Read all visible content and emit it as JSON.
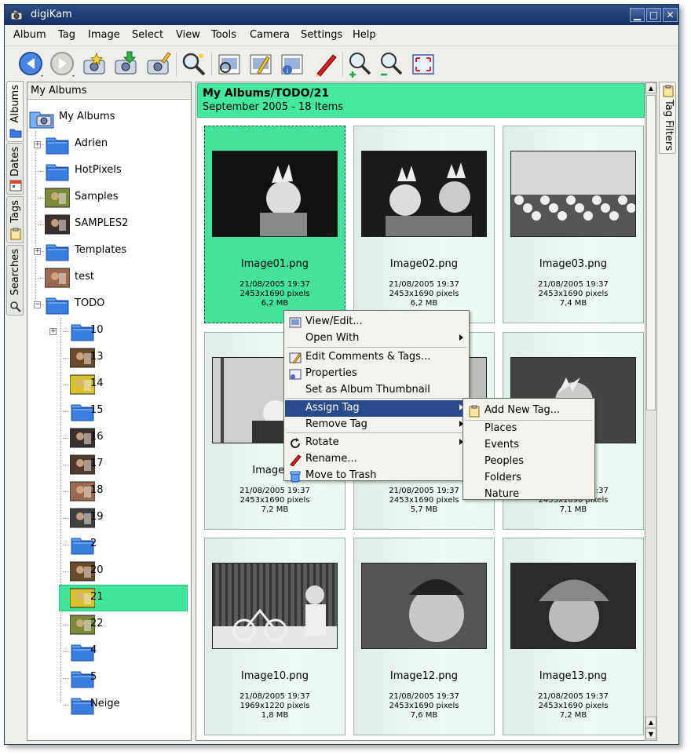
{
  "window": {
    "title": "digiKam"
  },
  "menubar": [
    {
      "label": "Album"
    },
    {
      "label": "Tag"
    },
    {
      "label": "Image"
    },
    {
      "label": "Select"
    },
    {
      "label": "View"
    },
    {
      "label": "Tools"
    },
    {
      "label": "Camera"
    },
    {
      "label": "Settings"
    },
    {
      "label": "Help"
    }
  ],
  "toolbar": [
    {
      "icon": "back-arrow-icon"
    },
    {
      "icon": "forward-arrow-icon"
    },
    {
      "icon": "new-album-camera-icon"
    },
    {
      "icon": "import-download-icon"
    },
    {
      "icon": "edit-album-icon"
    },
    {
      "icon": "search-magnifier-icon"
    },
    {
      "icon": "image-view-icon"
    },
    {
      "icon": "image-edit-icon"
    },
    {
      "icon": "image-properties-icon"
    },
    {
      "icon": "red-pencil-icon"
    },
    {
      "icon": "zoom-in-icon"
    },
    {
      "icon": "zoom-out-icon"
    },
    {
      "icon": "fullscreen-icon"
    }
  ],
  "left_tabs": [
    {
      "label": "Albums"
    },
    {
      "label": "Dates"
    },
    {
      "label": "Tags"
    },
    {
      "label": "Searches"
    }
  ],
  "right_tabs": [
    {
      "label": "Tag Filters"
    }
  ],
  "tree": {
    "header": "My Albums",
    "root": "My Albums",
    "items": [
      {
        "label": "Adrien",
        "icon": "folder"
      },
      {
        "label": "HotPixels",
        "icon": "folder"
      },
      {
        "label": "Samples",
        "icon": "photo"
      },
      {
        "label": "SAMPLES2",
        "icon": "photo"
      },
      {
        "label": "Templates",
        "icon": "folder"
      },
      {
        "label": "test",
        "icon": "photo"
      },
      {
        "label": "TODO",
        "icon": "folder"
      },
      {
        "label": "10",
        "icon": "folder"
      },
      {
        "label": "13",
        "icon": "photo"
      },
      {
        "label": "14",
        "icon": "photo"
      },
      {
        "label": "15",
        "icon": "folder"
      },
      {
        "label": "16",
        "icon": "photo"
      },
      {
        "label": "17",
        "icon": "photo"
      },
      {
        "label": "18",
        "icon": "photo"
      },
      {
        "label": "19",
        "icon": "photo"
      },
      {
        "label": "2",
        "icon": "folder"
      },
      {
        "label": "20",
        "icon": "photo"
      },
      {
        "label": "21",
        "icon": "photo",
        "selected": true
      },
      {
        "label": "22",
        "icon": "photo"
      },
      {
        "label": "4",
        "icon": "folder"
      },
      {
        "label": "5",
        "icon": "folder"
      },
      {
        "label": "Neige",
        "icon": "folder"
      }
    ]
  },
  "album": {
    "title": "My Albums/TODO/21",
    "subtitle": "September 2005 - 18 Items"
  },
  "thumbnails": [
    {
      "name": "Image01.png",
      "date": "21/08/2005 19:37",
      "dims": "2453x1690 pixels",
      "size": "6,2 MB",
      "selected": true
    },
    {
      "name": "Image02.png",
      "date": "21/08/2005 19:37",
      "dims": "2453x1690 pixels",
      "size": "6,2 MB"
    },
    {
      "name": "Image03.png",
      "date": "21/08/2005 19:37",
      "dims": "2453x1690 pixels",
      "size": "7,4 MB"
    },
    {
      "name": "Image04",
      "date": "21/08/2005 19:37",
      "dims": "2453x1690 pixels",
      "size": "7,2 MB"
    },
    {
      "name": "",
      "date": "21/08/2005 19:37",
      "dims": "2453x1690 pixels",
      "size": "5,7 MB"
    },
    {
      "name": "ng",
      "date": "21/08/2005 19:37",
      "dims": "2453x1690 pixels",
      "size": "7,1 MB"
    },
    {
      "name": "Image10.png",
      "date": "21/08/2005 19:37",
      "dims": "1969x1220 pixels",
      "size": "1,8 MB"
    },
    {
      "name": "Image12.png",
      "date": "21/08/2005 19:37",
      "dims": "2453x1690 pixels",
      "size": "7,6 MB"
    },
    {
      "name": "Image13.png",
      "date": "21/08/2005 19:37",
      "dims": "2453x1690 pixels",
      "size": "7,2 MB"
    }
  ],
  "context_menu": {
    "items": [
      {
        "label": "View/Edit...",
        "icon": "view-edit-icon"
      },
      {
        "label": "Open With",
        "submenu": true
      },
      {
        "label": "Edit Comments & Tags...",
        "icon": "edit-comments-icon"
      },
      {
        "label": "Properties",
        "icon": "properties-icon"
      },
      {
        "label": "Set as Album Thumbnail"
      },
      {
        "label": "Assign Tag",
        "submenu": true,
        "highlighted": true
      },
      {
        "label": "Remove Tag",
        "submenu": true
      },
      {
        "label": "Rotate",
        "icon": "rotate-icon",
        "submenu": true
      },
      {
        "label": "Rename...",
        "icon": "rename-pencil-icon"
      },
      {
        "label": "Move to Trash",
        "icon": "trash-icon"
      }
    ]
  },
  "tag_submenu": {
    "items": [
      {
        "label": "Add New Tag...",
        "icon": "new-tag-icon"
      },
      {
        "label": "Places"
      },
      {
        "label": "Events"
      },
      {
        "label": "Peoples"
      },
      {
        "label": "Folders"
      },
      {
        "label": "Nature"
      }
    ]
  },
  "colors": {
    "selection_green": "#44e89e",
    "title_blue": "#1d3a70",
    "menu_highlight": "#2a4b8a"
  }
}
